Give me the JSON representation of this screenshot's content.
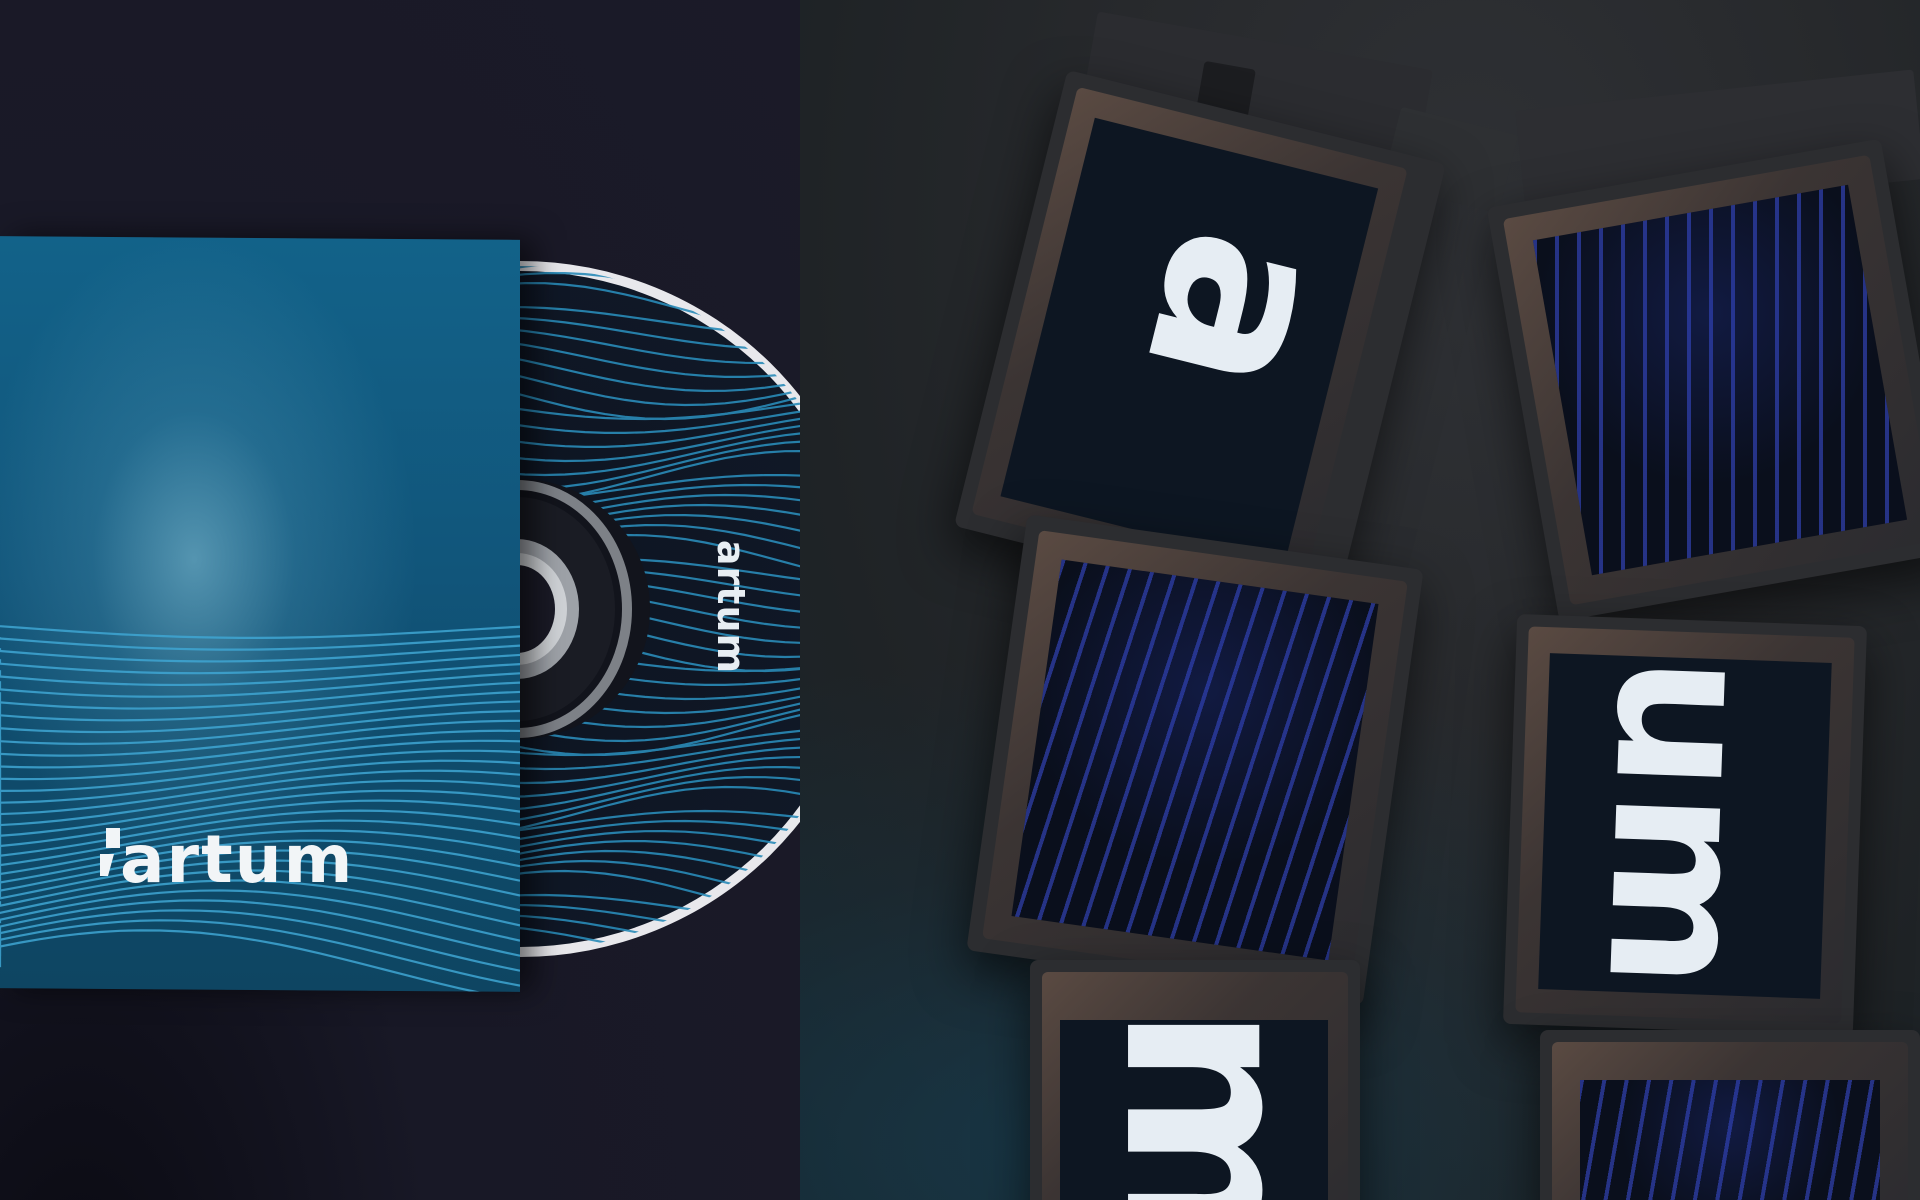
{
  "brand": {
    "sleeve_logo": "artum",
    "disc_logo": "artum"
  },
  "monitors": {
    "m1_glyph": "a",
    "m2_glyph": "",
    "m3_glyph": "",
    "m4_glyph": "um",
    "m5_glyph": "m",
    "m6_glyph": ""
  },
  "colors": {
    "left_background": "#181826",
    "sleeve_blue": "#11557a",
    "disc_rim": "#e6e6ea",
    "right_background": "#27292c",
    "screen_dark": "#0d1622",
    "screen_dots": "#3c50dc",
    "glyph": "#e6edf3"
  }
}
